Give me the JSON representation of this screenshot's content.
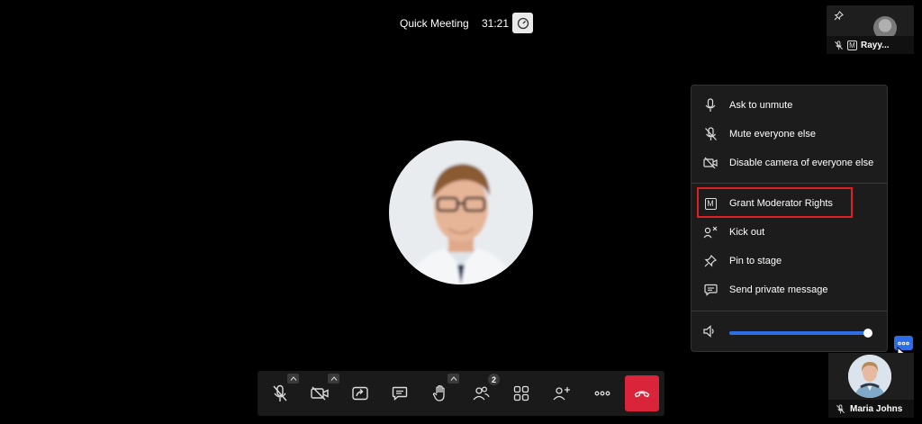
{
  "header": {
    "meeting_title": "Quick Meeting",
    "timer": "31:21"
  },
  "participants": {
    "top_tile": {
      "name": "Rayy...",
      "moderator_badge": "M"
    },
    "bottom_tile": {
      "name": "Maria Johns"
    }
  },
  "menu": {
    "items": [
      {
        "label": "Ask to unmute",
        "icon": "microphone-icon"
      },
      {
        "label": "Mute everyone else",
        "icon": "mic-off-icon"
      },
      {
        "label": "Disable camera of everyone else",
        "icon": "camera-off-icon"
      },
      {
        "label": "Grant Moderator Rights",
        "icon": "moderator-m-icon",
        "badge": "M"
      },
      {
        "label": "Kick out",
        "icon": "kick-user-icon"
      },
      {
        "label": "Pin to stage",
        "icon": "pin-icon"
      },
      {
        "label": "Send private message",
        "icon": "chat-icon"
      }
    ],
    "volume": 0.98
  },
  "toolbar": {
    "participants_count": "2",
    "buttons": [
      "mic-off-icon",
      "camera-off-icon",
      "share-screen-icon",
      "chat-icon",
      "raise-hand-icon",
      "participants-icon",
      "grid-view-icon",
      "add-user-icon",
      "more-icon",
      "end-call-icon"
    ]
  },
  "colors": {
    "accent": "#2e6fe6",
    "end_call": "#d9243a",
    "highlight": "#e02020"
  }
}
